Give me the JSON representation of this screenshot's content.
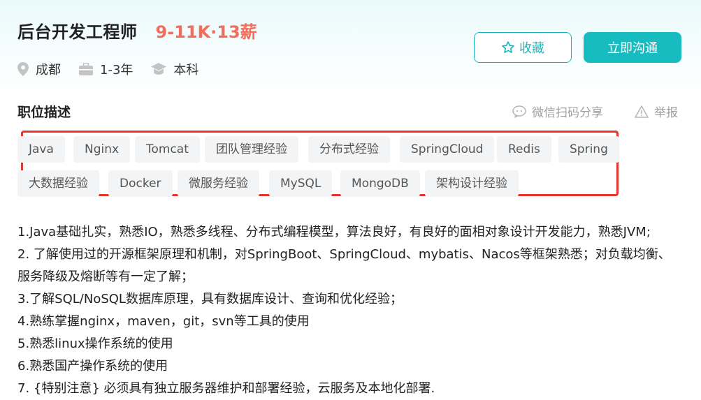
{
  "header": {
    "job_title": "后台开发工程师",
    "salary": "9-11K·13薪",
    "meta": {
      "city": "成都",
      "experience": "1-3年",
      "degree": "本科"
    }
  },
  "actions": {
    "favorite_label": "收藏",
    "chat_label": "立即沟通"
  },
  "section": {
    "title": "职位描述",
    "share_label": "微信扫码分享",
    "report_label": "举报"
  },
  "tags": {
    "row1": [
      "Java",
      "Nginx",
      "Tomcat",
      "团队管理经验",
      "分布式经验",
      "SpringCloud",
      "Redis",
      "Spring"
    ],
    "row2": [
      "大数据经验",
      "Docker",
      "微服务经验",
      "MySQL",
      "MongoDB",
      "架构设计经验"
    ]
  },
  "description": {
    "lines": [
      "1.Java基础扎实，熟悉IO，熟悉多线程、分布式编程模型，算法良好，有良好的面相对象设计开发能力，熟悉JVM;",
      "2. 了解使用过的开源框架原理和机制，对SpringBoot、SpringCloud、mybatis、Nacos等框架熟悉；对负载均衡、",
      "服务降级及熔断等有一定了解；",
      "3.了解SQL/NoSQL数据库原理，具有数据库设计、查询和优化经验；",
      "4.熟练掌握nginx，maven，git，svn等工具的使用",
      "5.熟悉linux操作系统的使用",
      "6.熟悉国产操作系统的使用",
      "7. {特别注意} 必须具有独立服务器维护和部署经验，云服务及本地化部署."
    ]
  },
  "colors": {
    "accent": "#16bcc0",
    "salary": "#f26d5b",
    "highlight_box": "#e8322c",
    "tag_bg": "#f3f4f5"
  }
}
